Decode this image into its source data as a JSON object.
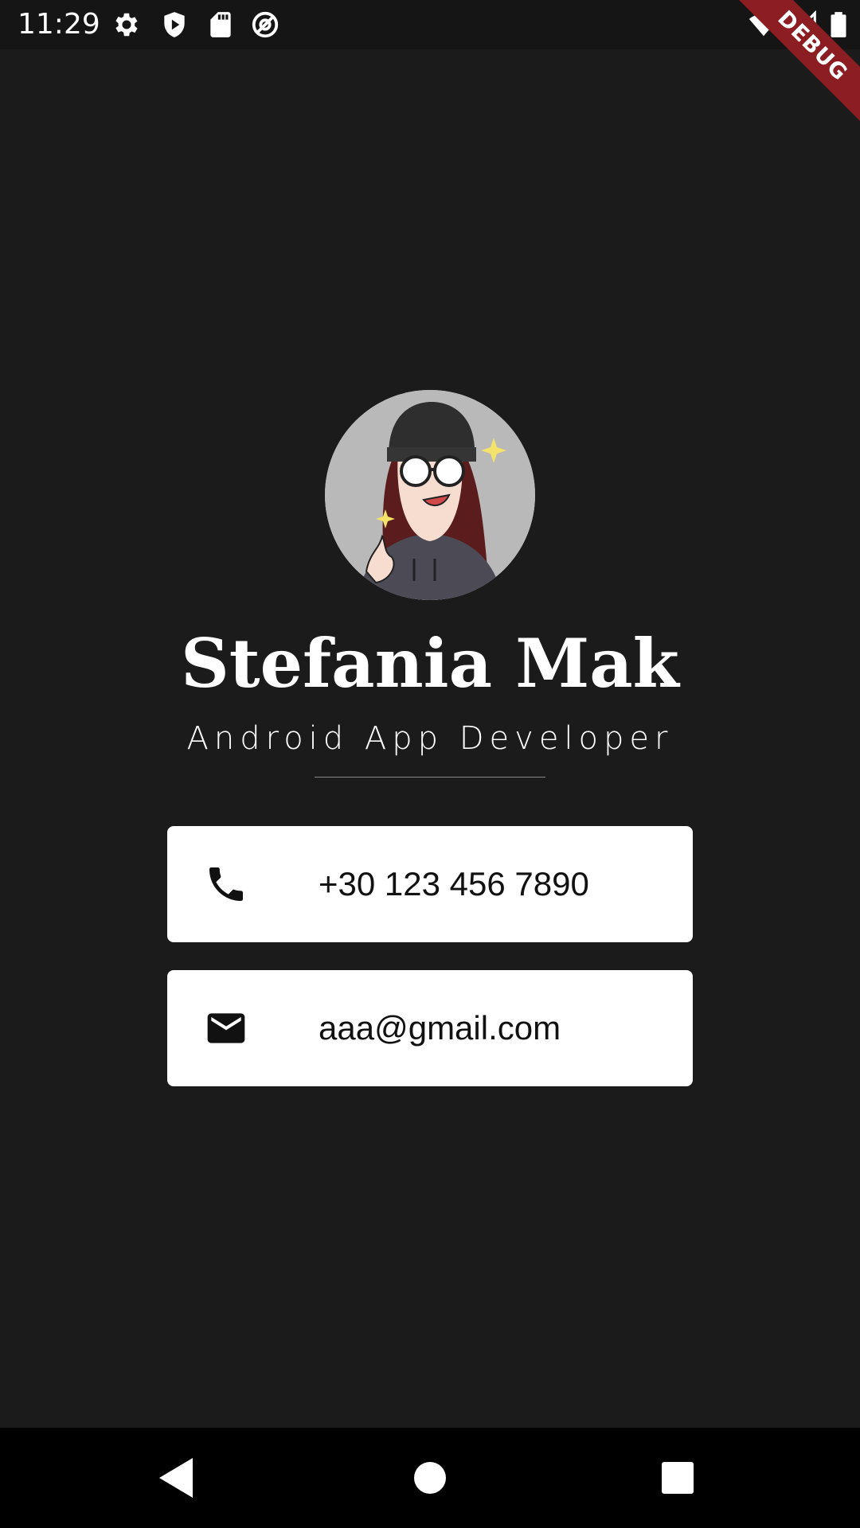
{
  "status_bar": {
    "time": "11:29",
    "icons": [
      "settings-icon",
      "shield-play-icon",
      "sd-card-icon",
      "at-sign-icon",
      "wifi-icon",
      "signal-icon",
      "battery-icon"
    ]
  },
  "debug_banner": "DEBUG",
  "profile": {
    "name": "Stefania Mak",
    "title": "Android App Developer"
  },
  "contacts": [
    {
      "icon": "phone-icon",
      "text": "+30 123 456 7890"
    },
    {
      "icon": "mail-icon",
      "text": "aaa@gmail.com"
    }
  ],
  "nav_bar": {
    "buttons": [
      "back-button",
      "home-button",
      "recents-button"
    ]
  },
  "colors": {
    "background": "#1b1b1b",
    "card": "#ffffff",
    "debug_ribbon": "#8c1d22",
    "avatar_bg": "#b9b9b9"
  }
}
